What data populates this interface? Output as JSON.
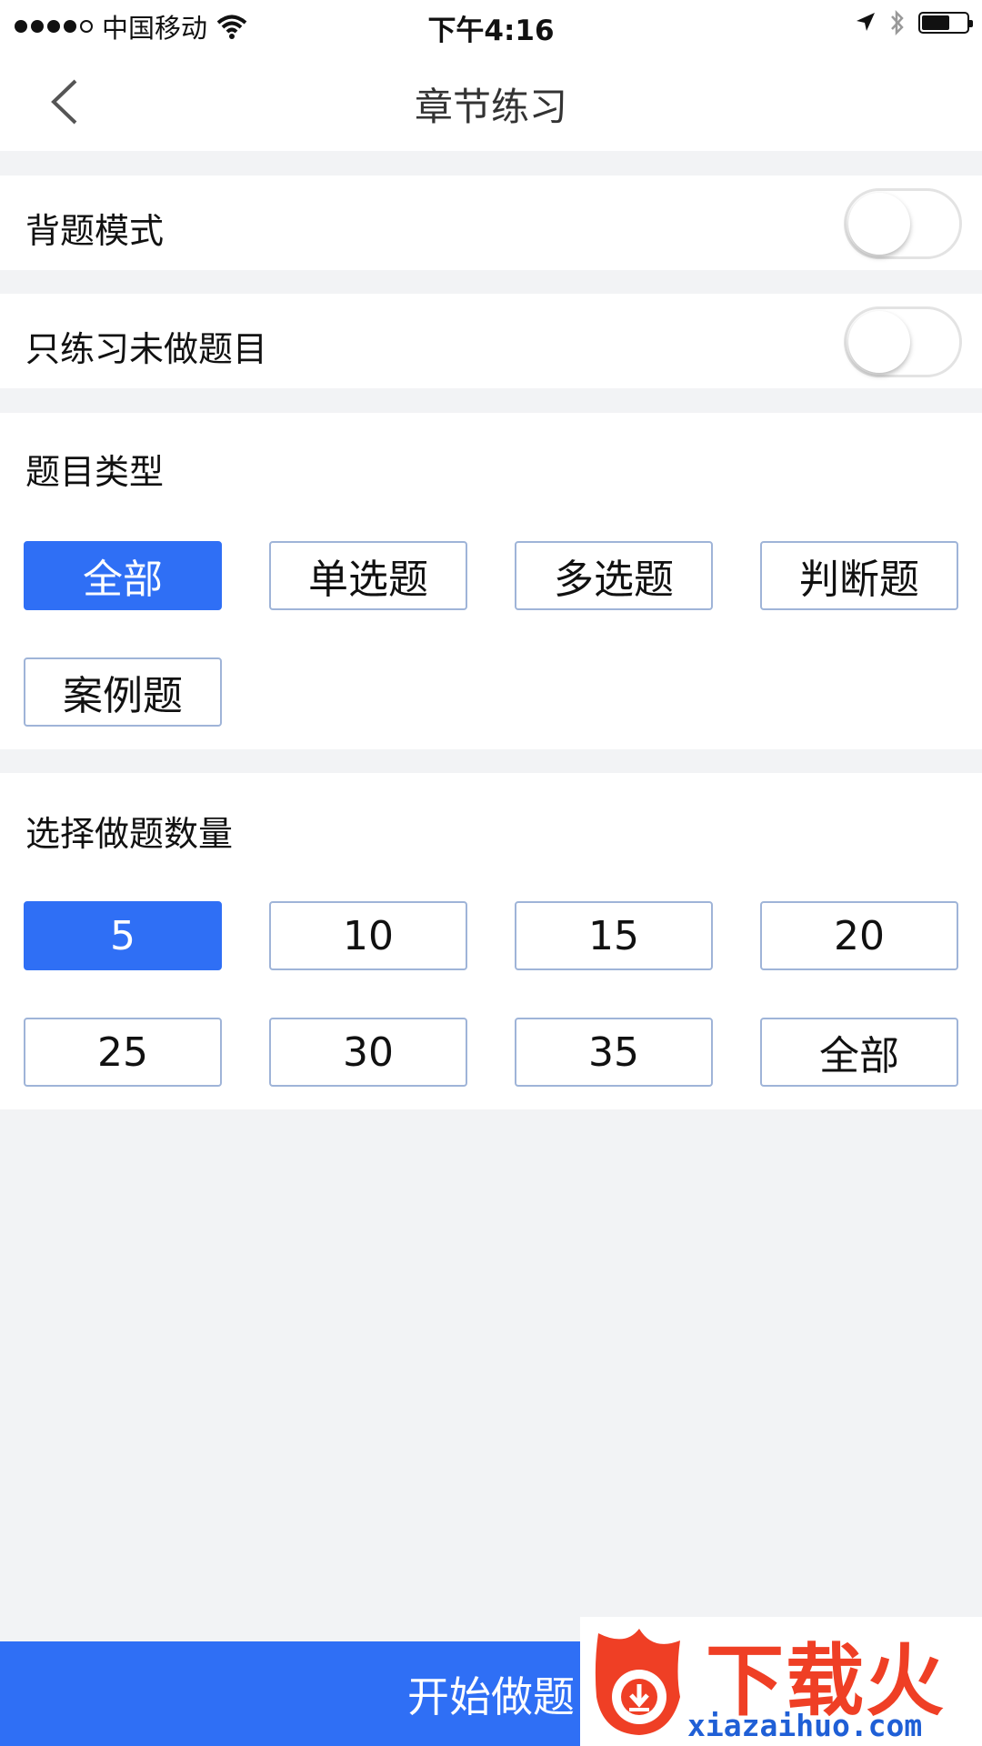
{
  "status_bar": {
    "carrier": "中国移动",
    "time": "下午4:16"
  },
  "header": {
    "title": "章节练习"
  },
  "settings": {
    "recite_mode_label": "背题模式",
    "recite_mode_on": false,
    "undone_only_label": "只练习未做题目",
    "undone_only_on": false
  },
  "question_type": {
    "title": "题目类型",
    "options": [
      "全部",
      "单选题",
      "多选题",
      "判断题",
      "案例题"
    ],
    "selected": "全部"
  },
  "question_count": {
    "title": "选择做题数量",
    "options": [
      "5",
      "10",
      "15",
      "20",
      "25",
      "30",
      "35",
      "全部"
    ],
    "selected": "5"
  },
  "start_button": {
    "label": "开始做题"
  },
  "watermark": {
    "brand": "下载火",
    "url": "xiazaihuo.com"
  },
  "colors": {
    "accent": "#2f6ff5",
    "background": "#f2f3f5",
    "watermark_red": "#ef3f25",
    "watermark_blue": "#1f5fd6"
  }
}
